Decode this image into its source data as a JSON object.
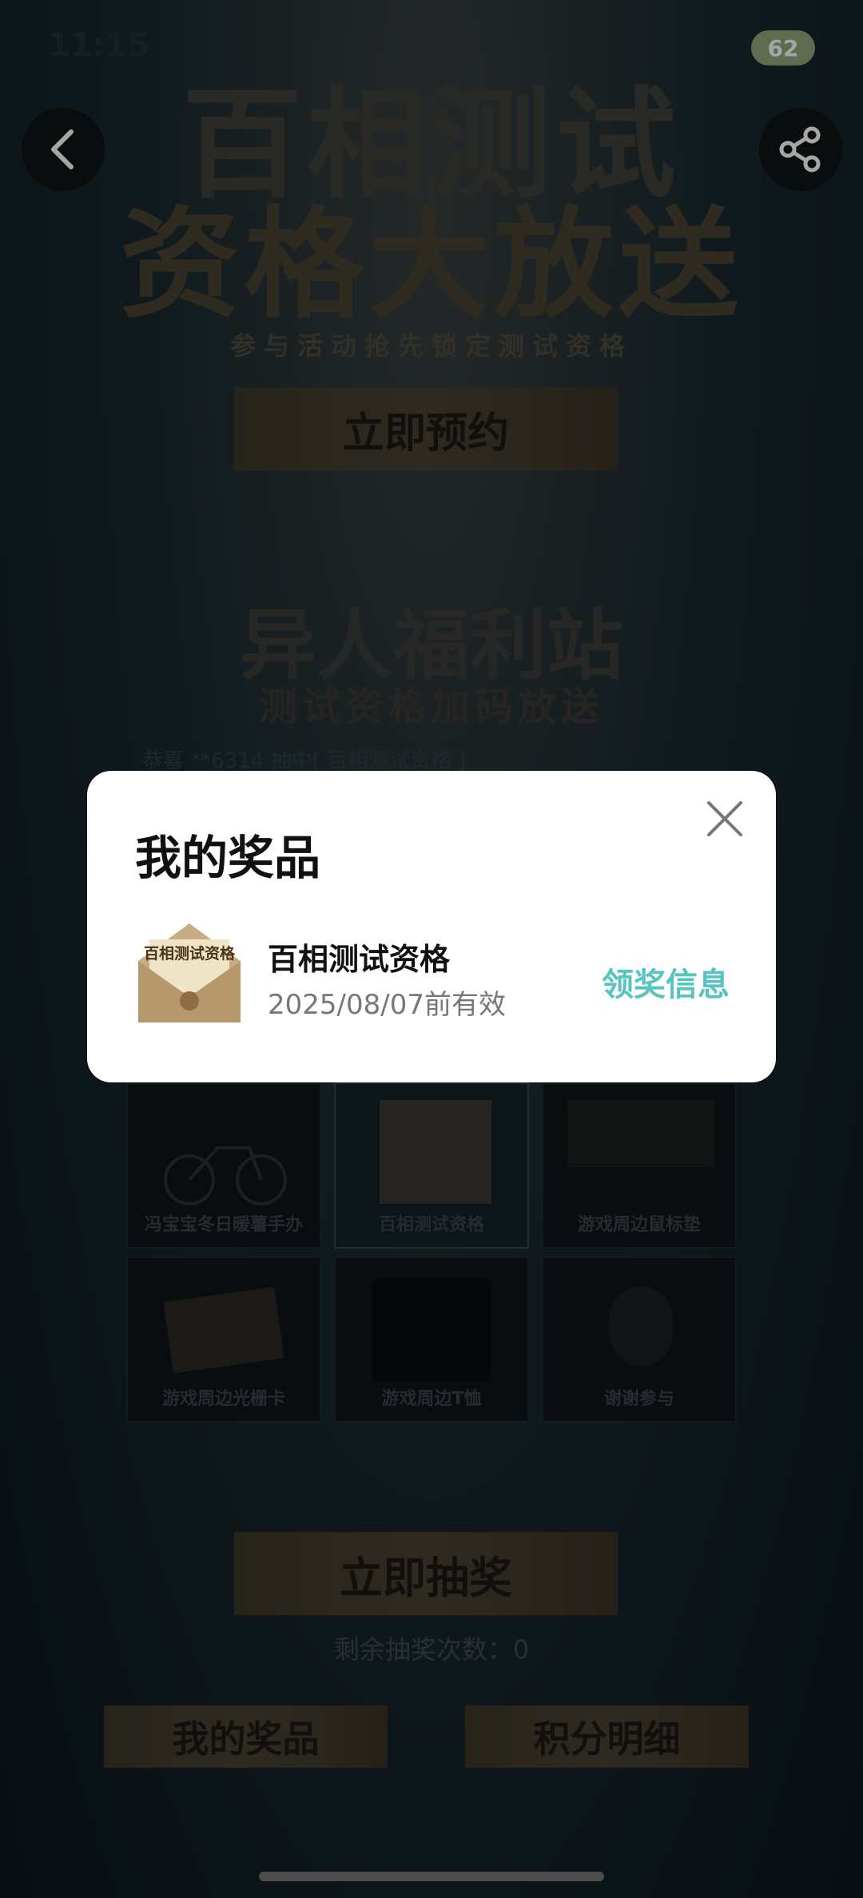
{
  "status_bar": {
    "time": "11:15",
    "battery": "62"
  },
  "hero": {
    "title_line1": "百相测试",
    "title_line2": "资格大放送",
    "subtitle": "参与活动抢先锁定测试资格",
    "reserve_button": "立即预约"
  },
  "welfare": {
    "title": "异人福利站",
    "subtitle": "测试资格加码放送",
    "ticker": "恭喜 **6314 抽中[ 百相测试资格 ]"
  },
  "prizes": [
    {
      "label": "冯宝宝冬日暖薯手办"
    },
    {
      "label": "百相测试资格"
    },
    {
      "label": "游戏周边鼠标垫"
    },
    {
      "label": "游戏周边光栅卡"
    },
    {
      "label": "游戏周边T恤"
    },
    {
      "label": "谢谢参与"
    }
  ],
  "draw": {
    "button": "立即抽奖",
    "remaining": "剩余抽奖次数：0"
  },
  "bottom_buttons": {
    "my_prizes": "我的奖品",
    "points_detail": "积分明细"
  },
  "modal": {
    "title": "我的奖品",
    "item_name": "百相测试资格",
    "item_expiry": "2025/08/07前有效",
    "claim_info": "领奖信息",
    "item_image_text": "百相测试资格"
  },
  "icons": {
    "back": "back-arrow-icon",
    "share": "share-icon",
    "close": "close-icon"
  },
  "colors": {
    "accent": "#56c4c0",
    "gold_button": "#4a4234",
    "background": "#0d1a20"
  }
}
